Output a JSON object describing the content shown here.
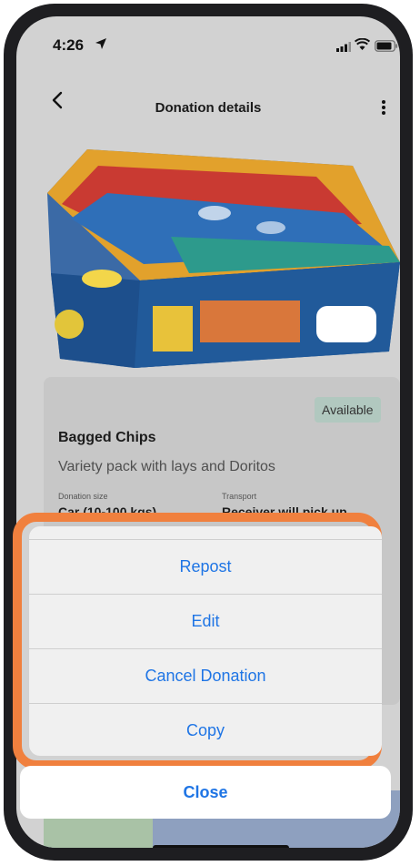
{
  "status": {
    "time": "4:26"
  },
  "nav": {
    "title": "Donation details"
  },
  "donation": {
    "status_badge": "Available",
    "title": "Bagged Chips",
    "description": "Variety pack with lays and Doritos",
    "size_label": "Donation size",
    "size_value": "Car (10-100 kgs)",
    "transport_label": "Transport",
    "transport_value": "Receiver will pick up"
  },
  "action_sheet": {
    "items": [
      "Repost",
      "Edit",
      "Cancel Donation",
      "Copy"
    ],
    "close_label": "Close"
  },
  "colors": {
    "accent_blue": "#1f75e5",
    "highlight_orange": "#f0803e",
    "badge_green": "#b1c8bf"
  }
}
